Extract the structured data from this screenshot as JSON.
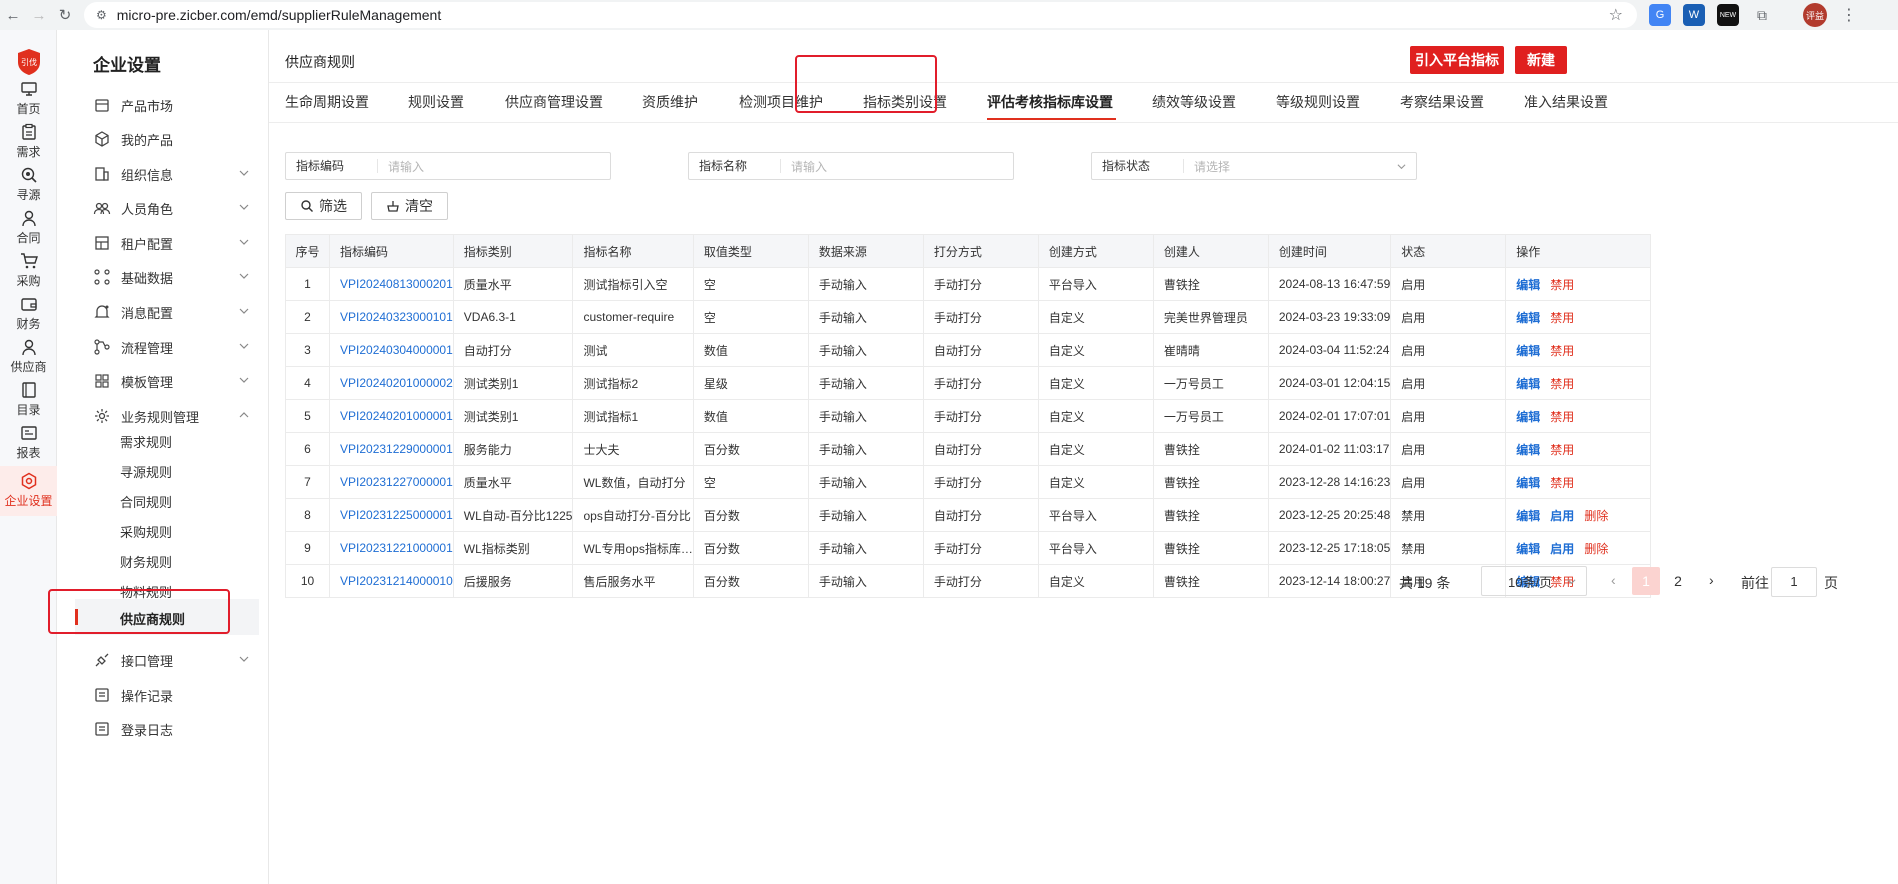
{
  "browser": {
    "url": "micro-pre.zicber.com/emd/supplierRuleManagement",
    "ext_new_badge": "NEW",
    "profile_label": "评益"
  },
  "rail": {
    "logo_text": "引伐",
    "items": [
      {
        "label": "首页",
        "icon": "monitor-icon"
      },
      {
        "label": "需求",
        "icon": "clipboard-icon"
      },
      {
        "label": "寻源",
        "icon": "search-target-icon"
      },
      {
        "label": "合同",
        "icon": "person-icon"
      },
      {
        "label": "采购",
        "icon": "cart-icon"
      },
      {
        "label": "财务",
        "icon": "wallet-icon"
      },
      {
        "label": "供应商",
        "icon": "person-icon"
      },
      {
        "label": "目录",
        "icon": "book-icon"
      },
      {
        "label": "报表",
        "icon": "report-icon"
      },
      {
        "label": "企业设置",
        "icon": "settings-icon"
      }
    ]
  },
  "menu": {
    "title": "企业设置",
    "items": [
      {
        "label": "产品市场",
        "icon": "store-icon",
        "expandable": false
      },
      {
        "label": "我的产品",
        "icon": "cube-icon",
        "expandable": false
      },
      {
        "label": "组织信息",
        "icon": "building-icon",
        "expandable": true
      },
      {
        "label": "人员角色",
        "icon": "users-icon",
        "expandable": true
      },
      {
        "label": "租户配置",
        "icon": "tenant-icon",
        "expandable": true
      },
      {
        "label": "基础数据",
        "icon": "nodes-icon",
        "expandable": true
      },
      {
        "label": "消息配置",
        "icon": "bell-icon",
        "expandable": true
      },
      {
        "label": "流程管理",
        "icon": "flow-icon",
        "expandable": true
      },
      {
        "label": "模板管理",
        "icon": "template-icon",
        "expandable": true
      },
      {
        "label": "业务规则管理",
        "icon": "gear-icon",
        "expandable": true
      }
    ],
    "sub_items": [
      "需求规则",
      "寻源规则",
      "合同规则",
      "采购规则",
      "财务规则",
      "物料规则"
    ],
    "active_sub": "供应商规则",
    "bottom_items": [
      {
        "label": "接口管理",
        "icon": "plug-icon",
        "expandable": true
      },
      {
        "label": "操作记录",
        "icon": "log-icon",
        "expandable": false
      },
      {
        "label": "登录日志",
        "icon": "log-icon",
        "expandable": false
      }
    ]
  },
  "main": {
    "page_title": "供应商规则",
    "import_button": "引入平台指标",
    "new_button": "新建",
    "tabs": [
      "生命周期设置",
      "规则设置",
      "供应商管理设置",
      "资质维护",
      "检测项目维护",
      "指标类别设置",
      "评估考核指标库设置",
      "绩效等级设置",
      "等级规则设置",
      "考察结果设置",
      "准入结果设置"
    ],
    "active_tab": "评估考核指标库设置",
    "filters": [
      {
        "label": "指标编码",
        "placeholder": "请输入"
      },
      {
        "label": "指标名称",
        "placeholder": "请输入"
      },
      {
        "label": "指标状态",
        "placeholder": "请选择"
      }
    ],
    "filter_button": "筛选",
    "clear_button": "清空",
    "table": {
      "columns": [
        "序号",
        "指标编码",
        "指标类别",
        "指标名称",
        "取值类型",
        "数据来源",
        "打分方式",
        "创建方式",
        "创建人",
        "创建时间",
        "状态",
        "操作"
      ],
      "rows": [
        {
          "no": "1",
          "code": "VPI20240813000201",
          "category": "质量水平",
          "name": "测试指标引入空",
          "value_type": "空",
          "source": "手动输入",
          "scoring": "手动打分",
          "create_mode": "平台导入",
          "creator": "曹铁拴",
          "created_at": "2024-08-13 16:47:59",
          "status": "启用",
          "actions": [
            "编辑",
            "禁用"
          ]
        },
        {
          "no": "2",
          "code": "VPI20240323000101",
          "category": "VDA6.3-1",
          "name": "customer-require",
          "value_type": "空",
          "source": "手动输入",
          "scoring": "手动打分",
          "create_mode": "自定义",
          "creator": "完美世界管理员",
          "created_at": "2024-03-23 19:33:09",
          "status": "启用",
          "actions": [
            "编辑",
            "禁用"
          ]
        },
        {
          "no": "3",
          "code": "VPI20240304000001",
          "category": "自动打分",
          "name": "测试",
          "value_type": "数值",
          "source": "手动输入",
          "scoring": "自动打分",
          "create_mode": "自定义",
          "creator": "崔晴晴",
          "created_at": "2024-03-04 11:52:24",
          "status": "启用",
          "actions": [
            "编辑",
            "禁用"
          ]
        },
        {
          "no": "4",
          "code": "VPI20240201000002",
          "category": "测试类别1",
          "name": "测试指标2",
          "value_type": "星级",
          "source": "手动输入",
          "scoring": "手动打分",
          "create_mode": "自定义",
          "creator": "一万号员工",
          "created_at": "2024-03-01 12:04:15",
          "status": "启用",
          "actions": [
            "编辑",
            "禁用"
          ]
        },
        {
          "no": "5",
          "code": "VPI20240201000001",
          "category": "测试类别1",
          "name": "测试指标1",
          "value_type": "数值",
          "source": "手动输入",
          "scoring": "手动打分",
          "create_mode": "自定义",
          "creator": "一万号员工",
          "created_at": "2024-02-01 17:07:01",
          "status": "启用",
          "actions": [
            "编辑",
            "禁用"
          ]
        },
        {
          "no": "6",
          "code": "VPI20231229000001",
          "category": "服务能力",
          "name": "士大夫",
          "value_type": "百分数",
          "source": "手动输入",
          "scoring": "自动打分",
          "create_mode": "自定义",
          "creator": "曹铁拴",
          "created_at": "2024-01-02 11:03:17",
          "status": "启用",
          "actions": [
            "编辑",
            "禁用"
          ]
        },
        {
          "no": "7",
          "code": "VPI20231227000001",
          "category": "质量水平",
          "name": "WL数值，自动打分",
          "value_type": "空",
          "source": "手动输入",
          "scoring": "手动打分",
          "create_mode": "自定义",
          "creator": "曹铁拴",
          "created_at": "2023-12-28 14:16:23",
          "status": "启用",
          "actions": [
            "编辑",
            "禁用"
          ]
        },
        {
          "no": "8",
          "code": "VPI20231225000001",
          "category": "WL自动-百分比1225",
          "name": "ops自动打分-百分比",
          "value_type": "百分数",
          "source": "手动输入",
          "scoring": "自动打分",
          "create_mode": "平台导入",
          "creator": "曹铁拴",
          "created_at": "2023-12-25 20:25:48",
          "status": "禁用",
          "actions": [
            "编辑",
            "启用",
            "删除"
          ]
        },
        {
          "no": "9",
          "code": "VPI20231221000001",
          "category": "WL指标类别",
          "name": "WL专用ops指标库…",
          "value_type": "百分数",
          "source": "手动输入",
          "scoring": "手动打分",
          "create_mode": "平台导入",
          "creator": "曹铁拴",
          "created_at": "2023-12-25 17:18:05",
          "status": "禁用",
          "actions": [
            "编辑",
            "启用",
            "删除"
          ]
        },
        {
          "no": "10",
          "code": "VPI20231214000010",
          "category": "后援服务",
          "name": "售后服务水平",
          "value_type": "百分数",
          "source": "手动输入",
          "scoring": "手动打分",
          "create_mode": "自定义",
          "creator": "曹铁拴",
          "created_at": "2023-12-14 18:00:27",
          "status": "启用",
          "actions": [
            "编辑",
            "禁用"
          ]
        }
      ]
    },
    "pagination": {
      "total": "共 19 条",
      "page_size": "10条/页",
      "prev": "‹",
      "pages": [
        "1",
        "2"
      ],
      "active_page": "1",
      "next": "›",
      "goto_label": "前往",
      "goto_value": "1",
      "goto_suffix": "页"
    }
  },
  "colors": {
    "accent": "#e0301e",
    "link": "#1f6ed4",
    "highlight_box": "#e11d2b"
  }
}
